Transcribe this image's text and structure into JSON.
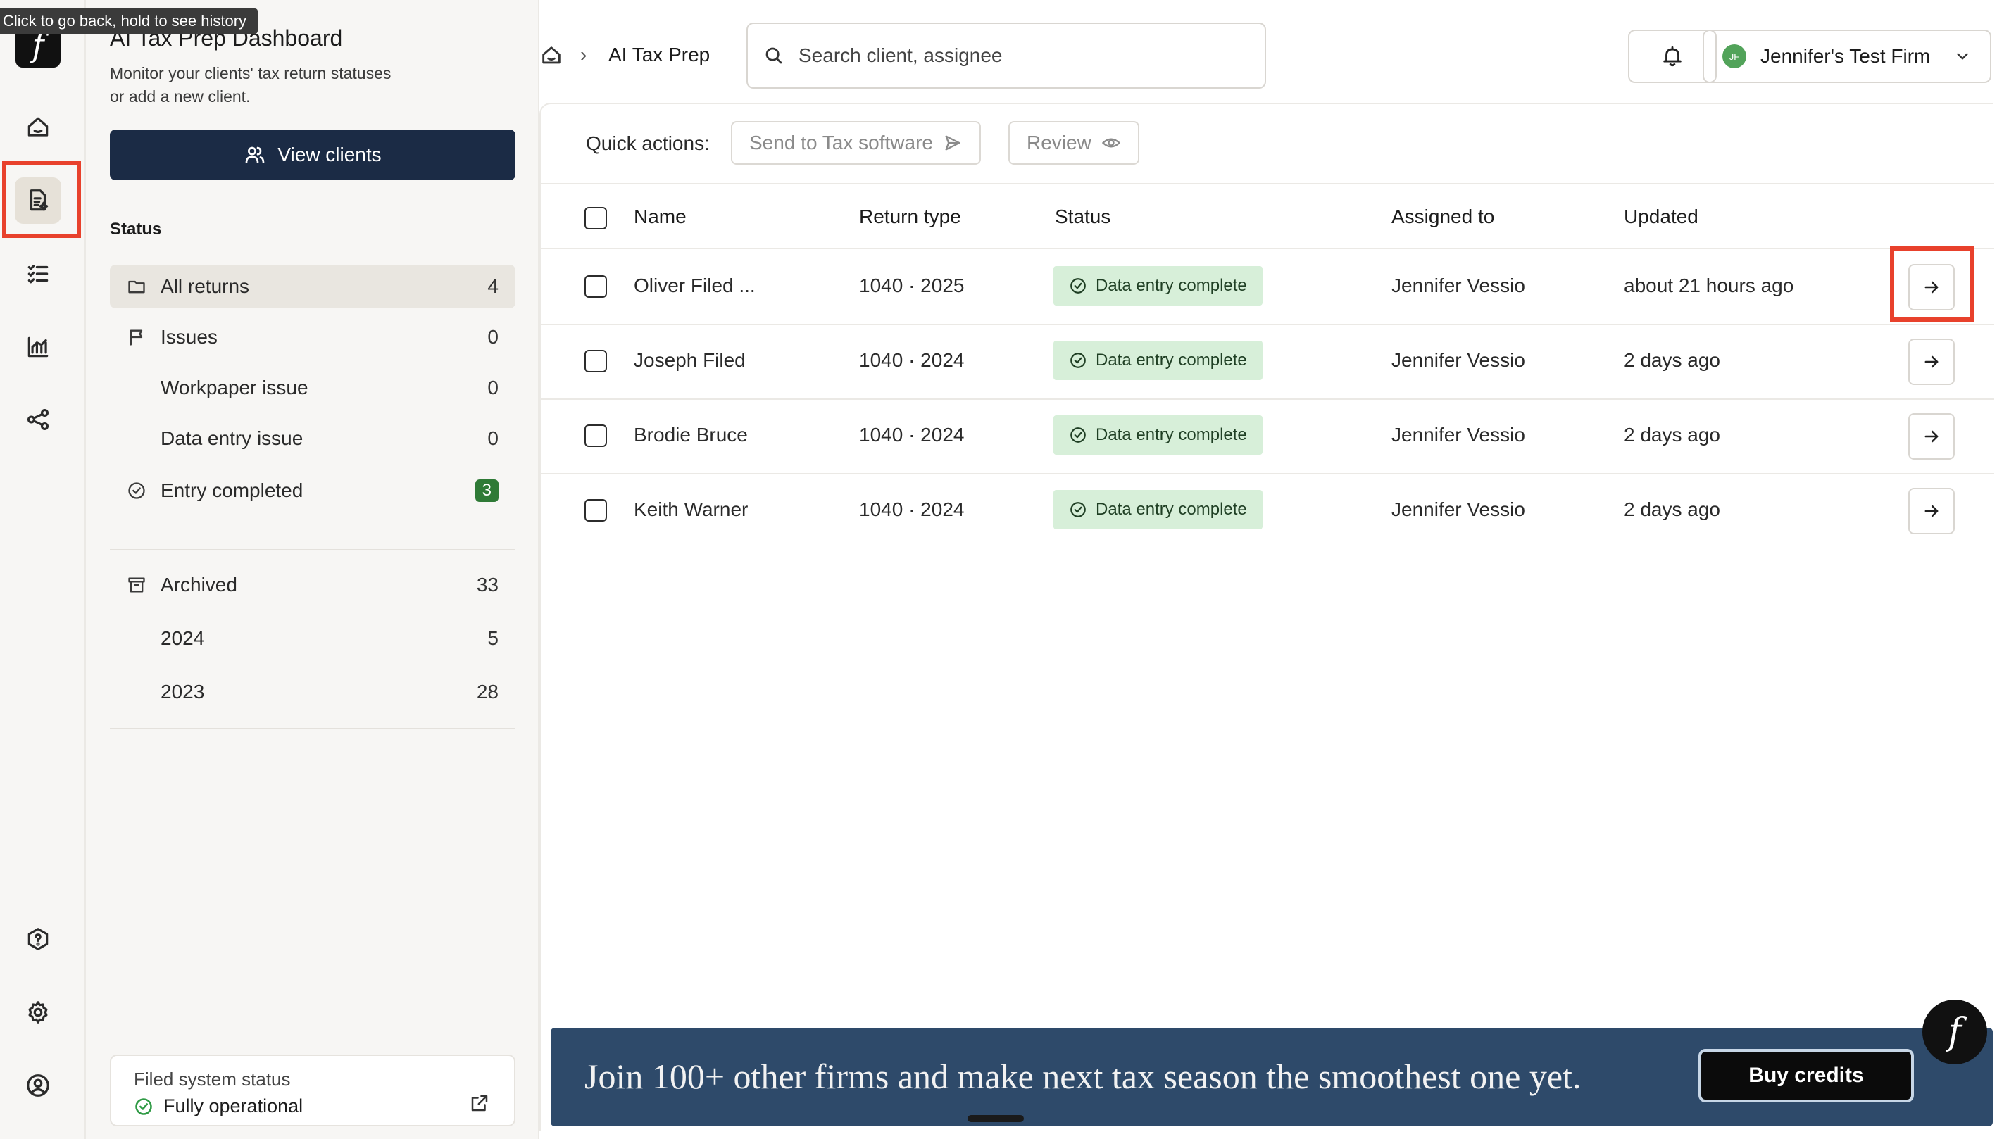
{
  "tooltip": "Click to go back, hold to see history",
  "rail": {
    "logo_glyph": "f",
    "items": [
      {
        "icon": "home-icon"
      },
      {
        "icon": "tax-document-icon",
        "active": true
      },
      {
        "icon": "checklist-icon"
      },
      {
        "icon": "chart-icon"
      },
      {
        "icon": "share-icon"
      }
    ],
    "bottom": [
      {
        "icon": "help-icon"
      },
      {
        "icon": "settings-icon"
      },
      {
        "icon": "user-circle-icon"
      }
    ]
  },
  "panel": {
    "title": "AI Tax Prep Dashboard",
    "subtitle": "Monitor your clients' tax return statuses or add a new client.",
    "view_clients": "View clients",
    "status_label": "Status",
    "items": [
      {
        "label": "All returns",
        "count": "4",
        "icon": "folder-icon"
      },
      {
        "label": "Issues",
        "count": "0",
        "icon": "flag-icon"
      },
      {
        "label": "Workpaper issue",
        "count": "0"
      },
      {
        "label": "Data entry issue",
        "count": "0"
      },
      {
        "label": "Entry completed",
        "count": "3",
        "icon": "check-circle-icon"
      }
    ],
    "archive": [
      {
        "label": "Archived",
        "count": "33",
        "icon": "archive-icon"
      },
      {
        "label": "2024",
        "count": "5"
      },
      {
        "label": "2023",
        "count": "28"
      }
    ],
    "system_status": {
      "label": "Filed system status",
      "value": "Fully operational"
    }
  },
  "topbar": {
    "breadcrumb": "AI Tax Prep",
    "search_placeholder": "Search client, assignee",
    "firm_initials": "JF",
    "firm_name": "Jennifer's Test Firm"
  },
  "main": {
    "quick_actions_label": "Quick actions:",
    "send_to_tax": "Send to Tax software",
    "review": "Review",
    "columns": [
      "Name",
      "Return type",
      "Status",
      "Assigned to",
      "Updated"
    ],
    "rows": [
      {
        "name": "Oliver Filed ...",
        "return_type": "1040 · 2025",
        "status": "Data entry complete",
        "assigned": "Jennifer Vessio",
        "updated": "about 21 hours ago"
      },
      {
        "name": "Joseph Filed",
        "return_type": "1040 · 2024",
        "status": "Data entry complete",
        "assigned": "Jennifer Vessio",
        "updated": "2 days ago"
      },
      {
        "name": "Brodie Bruce",
        "return_type": "1040 · 2024",
        "status": "Data entry complete",
        "assigned": "Jennifer Vessio",
        "updated": "2 days ago"
      },
      {
        "name": "Keith Warner",
        "return_type": "1040 · 2024",
        "status": "Data entry complete",
        "assigned": "Jennifer Vessio",
        "updated": "2 days ago"
      }
    ]
  },
  "promo": {
    "text": "Join 100+ other firms and make next tax season the smoothest one yet.",
    "button": "Buy credits"
  },
  "fab_glyph": "f",
  "colors": {
    "accent_navy": "#1b2b45",
    "status_green_bg": "#d7efd9",
    "highlight_red": "#e8412c",
    "promo_bg": "#2e4a6a"
  }
}
